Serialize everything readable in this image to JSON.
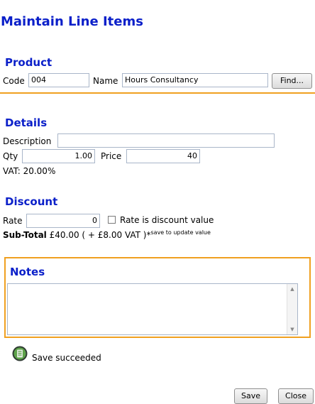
{
  "page_title": "Maintain Line Items",
  "product": {
    "heading": "Product",
    "code_label": "Code",
    "code_value": "004",
    "name_label": "Name",
    "name_value": "Hours Consultancy",
    "find_button": "Find..."
  },
  "details": {
    "heading": "Details",
    "description_label": "Description",
    "description_value": "",
    "qty_label": "Qty",
    "qty_value": "1.00",
    "price_label": "Price",
    "price_value": "40",
    "vat_text": "VAT: 20.00%"
  },
  "discount": {
    "heading": "Discount",
    "rate_label": "Rate",
    "rate_value": "0",
    "checkbox_label": "Rate is discount value",
    "checkbox_checked": false,
    "subtotal_label": "Sub-Total",
    "subtotal_value": "£40.00 ( + £8.00 VAT )",
    "asterisk": "*",
    "save_note": "save to update value"
  },
  "notes": {
    "heading": "Notes",
    "value": ""
  },
  "status": {
    "icon": "save-disk-icon",
    "message": "Save succeeded"
  },
  "footer": {
    "save_button": "Save",
    "close_button": "Close"
  },
  "colors": {
    "heading": "#0a1fc9",
    "accent": "#f0a020"
  }
}
